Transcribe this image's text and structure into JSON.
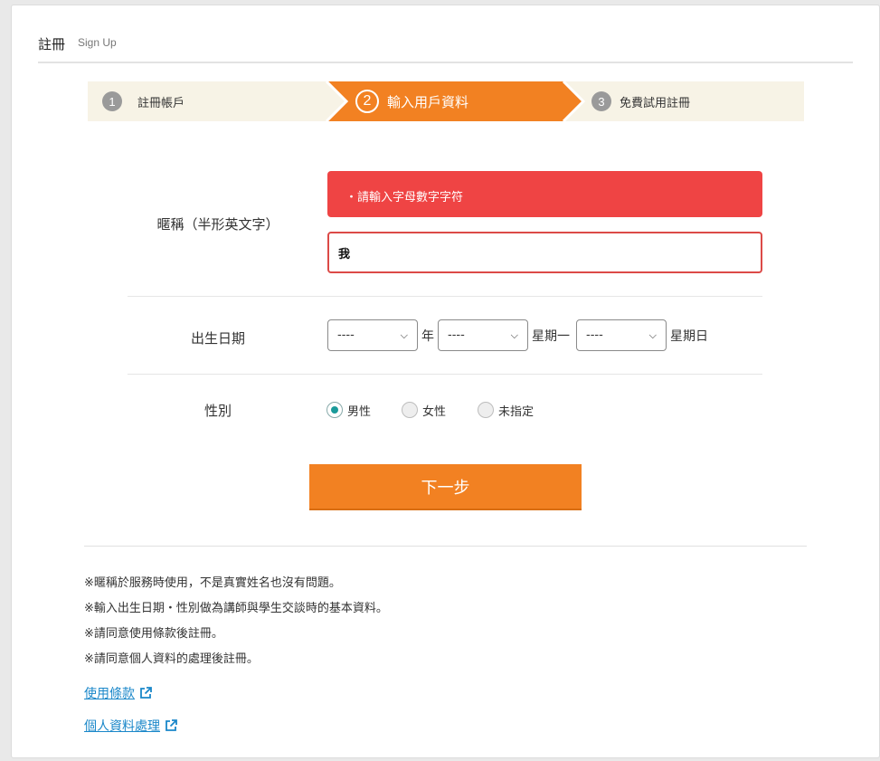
{
  "header": {
    "title": "註冊",
    "subtitle": "Sign Up"
  },
  "steps": [
    {
      "num": "1",
      "label": "註冊帳戶"
    },
    {
      "num": "2",
      "label": "輸入用戶資料"
    },
    {
      "num": "3",
      "label": "免費試用註冊"
    }
  ],
  "colors": {
    "accent": "#f28122",
    "error": "#ef4444",
    "step_bg": "#f7f3e6"
  },
  "form": {
    "nickname": {
      "label": "暱稱（半形英文字）",
      "error": "・請輸入字母數字字符",
      "value": "我"
    },
    "birth": {
      "label": "出生日期",
      "year_value": "----",
      "year_unit": "年",
      "month_value": "----",
      "month_unit": "星期一",
      "day_value": "----",
      "day_unit": "星期日"
    },
    "gender": {
      "label": "性別",
      "options": [
        "男性",
        "女性",
        "未指定"
      ],
      "selected": "男性"
    }
  },
  "next_button": "下一步",
  "notes": [
    "※暱稱於服務時使用，不是真實姓名也沒有問題。",
    "※輸入出生日期・性別做為講師與學生交談時的基本資料。",
    "※請同意使用條款後註冊。",
    "※請同意個人資料的處理後註冊。"
  ],
  "links": {
    "terms": "使用條款",
    "privacy": "個人資料處理"
  }
}
